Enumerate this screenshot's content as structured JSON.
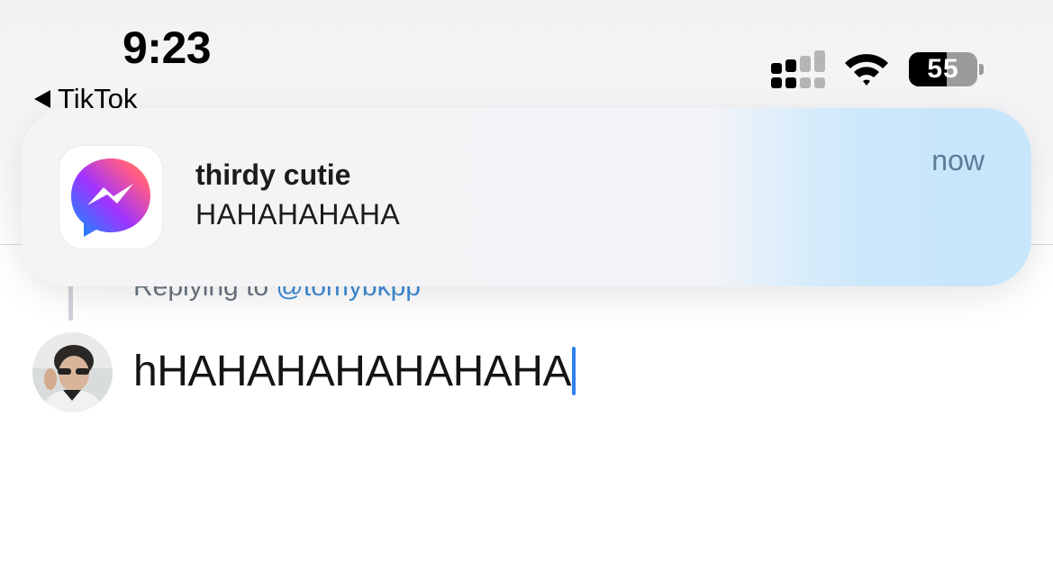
{
  "status_bar": {
    "time": "9:23",
    "back_app": "TikTok",
    "battery_level": "55",
    "battery_fraction": 0.55
  },
  "reply_context": {
    "prefix": "Replying to",
    "handle": "@tomybkpp"
  },
  "composer": {
    "text": "hHAHAHAHAHAHAHA"
  },
  "notification": {
    "sender": "thirdy cutie",
    "message": "HAHAHAHAHA",
    "time": "now",
    "app_icon": "messenger-icon"
  },
  "colors": {
    "caret": "#2f80ed",
    "handle_link": "#3d8bd6",
    "messenger_gradient_start": "#a033ff",
    "messenger_gradient_end": "#0695ff"
  }
}
